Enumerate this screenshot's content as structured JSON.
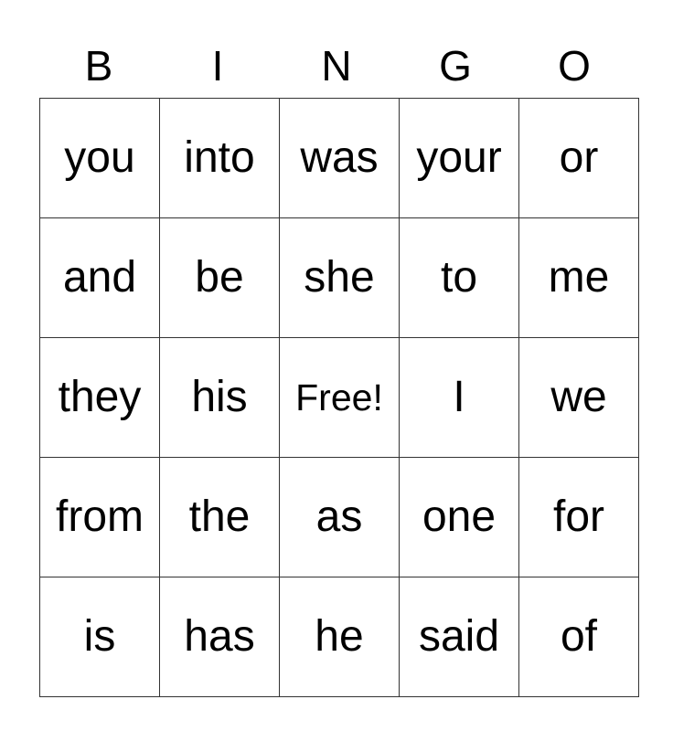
{
  "header": [
    "B",
    "I",
    "N",
    "G",
    "O"
  ],
  "rows": [
    [
      "you",
      "into",
      "was",
      "your",
      "or"
    ],
    [
      "and",
      "be",
      "she",
      "to",
      "me"
    ],
    [
      "they",
      "his",
      "Free!",
      "I",
      "we"
    ],
    [
      "from",
      "the",
      "as",
      "one",
      "for"
    ],
    [
      "is",
      "has",
      "he",
      "said",
      "of"
    ]
  ],
  "free_space": {
    "row": 2,
    "col": 2
  }
}
